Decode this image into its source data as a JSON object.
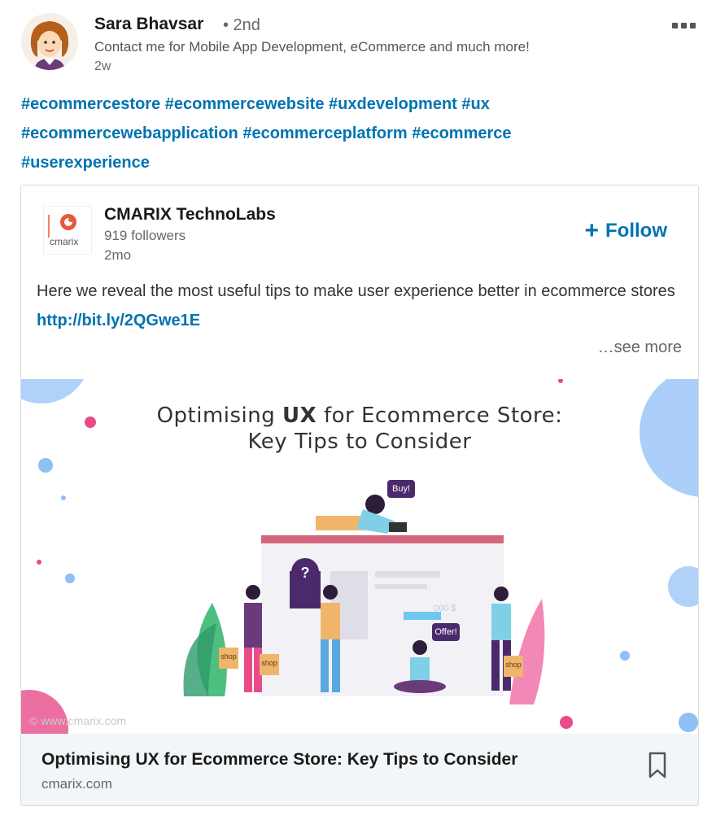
{
  "post": {
    "author_name": "Sara Bhavsar",
    "connection_degree": "• 2nd",
    "headline": "Contact me for Mobile App Development, eCommerce and much more!",
    "time": "2w",
    "more_icon": "ellipsis-icon",
    "hashtags": [
      "#ecommercestore",
      "#ecommercewebsite",
      "#uxdevelopment",
      "#ux",
      "#ecommercewebapplication",
      "#ecommerceplatform",
      "#ecommerce",
      "#userexperience"
    ]
  },
  "shared": {
    "company_name": "CMARIX TechnoLabs",
    "logo_text": "cmarix",
    "followers": "919 followers",
    "time": "2mo",
    "follow_label": "Follow",
    "text": "Here we reveal the most useful tips to make user experience better in ecommerce stores",
    "link": "http://bit.ly/2QGwe1E",
    "see_more": "…see more"
  },
  "article": {
    "banner_line1_pre": "Optimising ",
    "banner_line1_bold": "UX",
    "banner_line1_post": " for Ecommerce Store:",
    "banner_line2": "Key Tips to Consider",
    "bubble_buy": "Buy!",
    "bubble_offer": "Offer!",
    "bubble_question": "?",
    "bag_shop": "shop",
    "price": "000 $",
    "watermark": "© www.cmarix.com",
    "title": "Optimising UX for Ecommerce Store: Key Tips to Consider",
    "source": "cmarix.com"
  },
  "colors": {
    "link": "#0073b1",
    "accent_purple": "#4b2a6b",
    "accent_blue": "#8fbff5",
    "accent_pink": "#e94b8a",
    "accent_green": "#4fbf7f"
  }
}
